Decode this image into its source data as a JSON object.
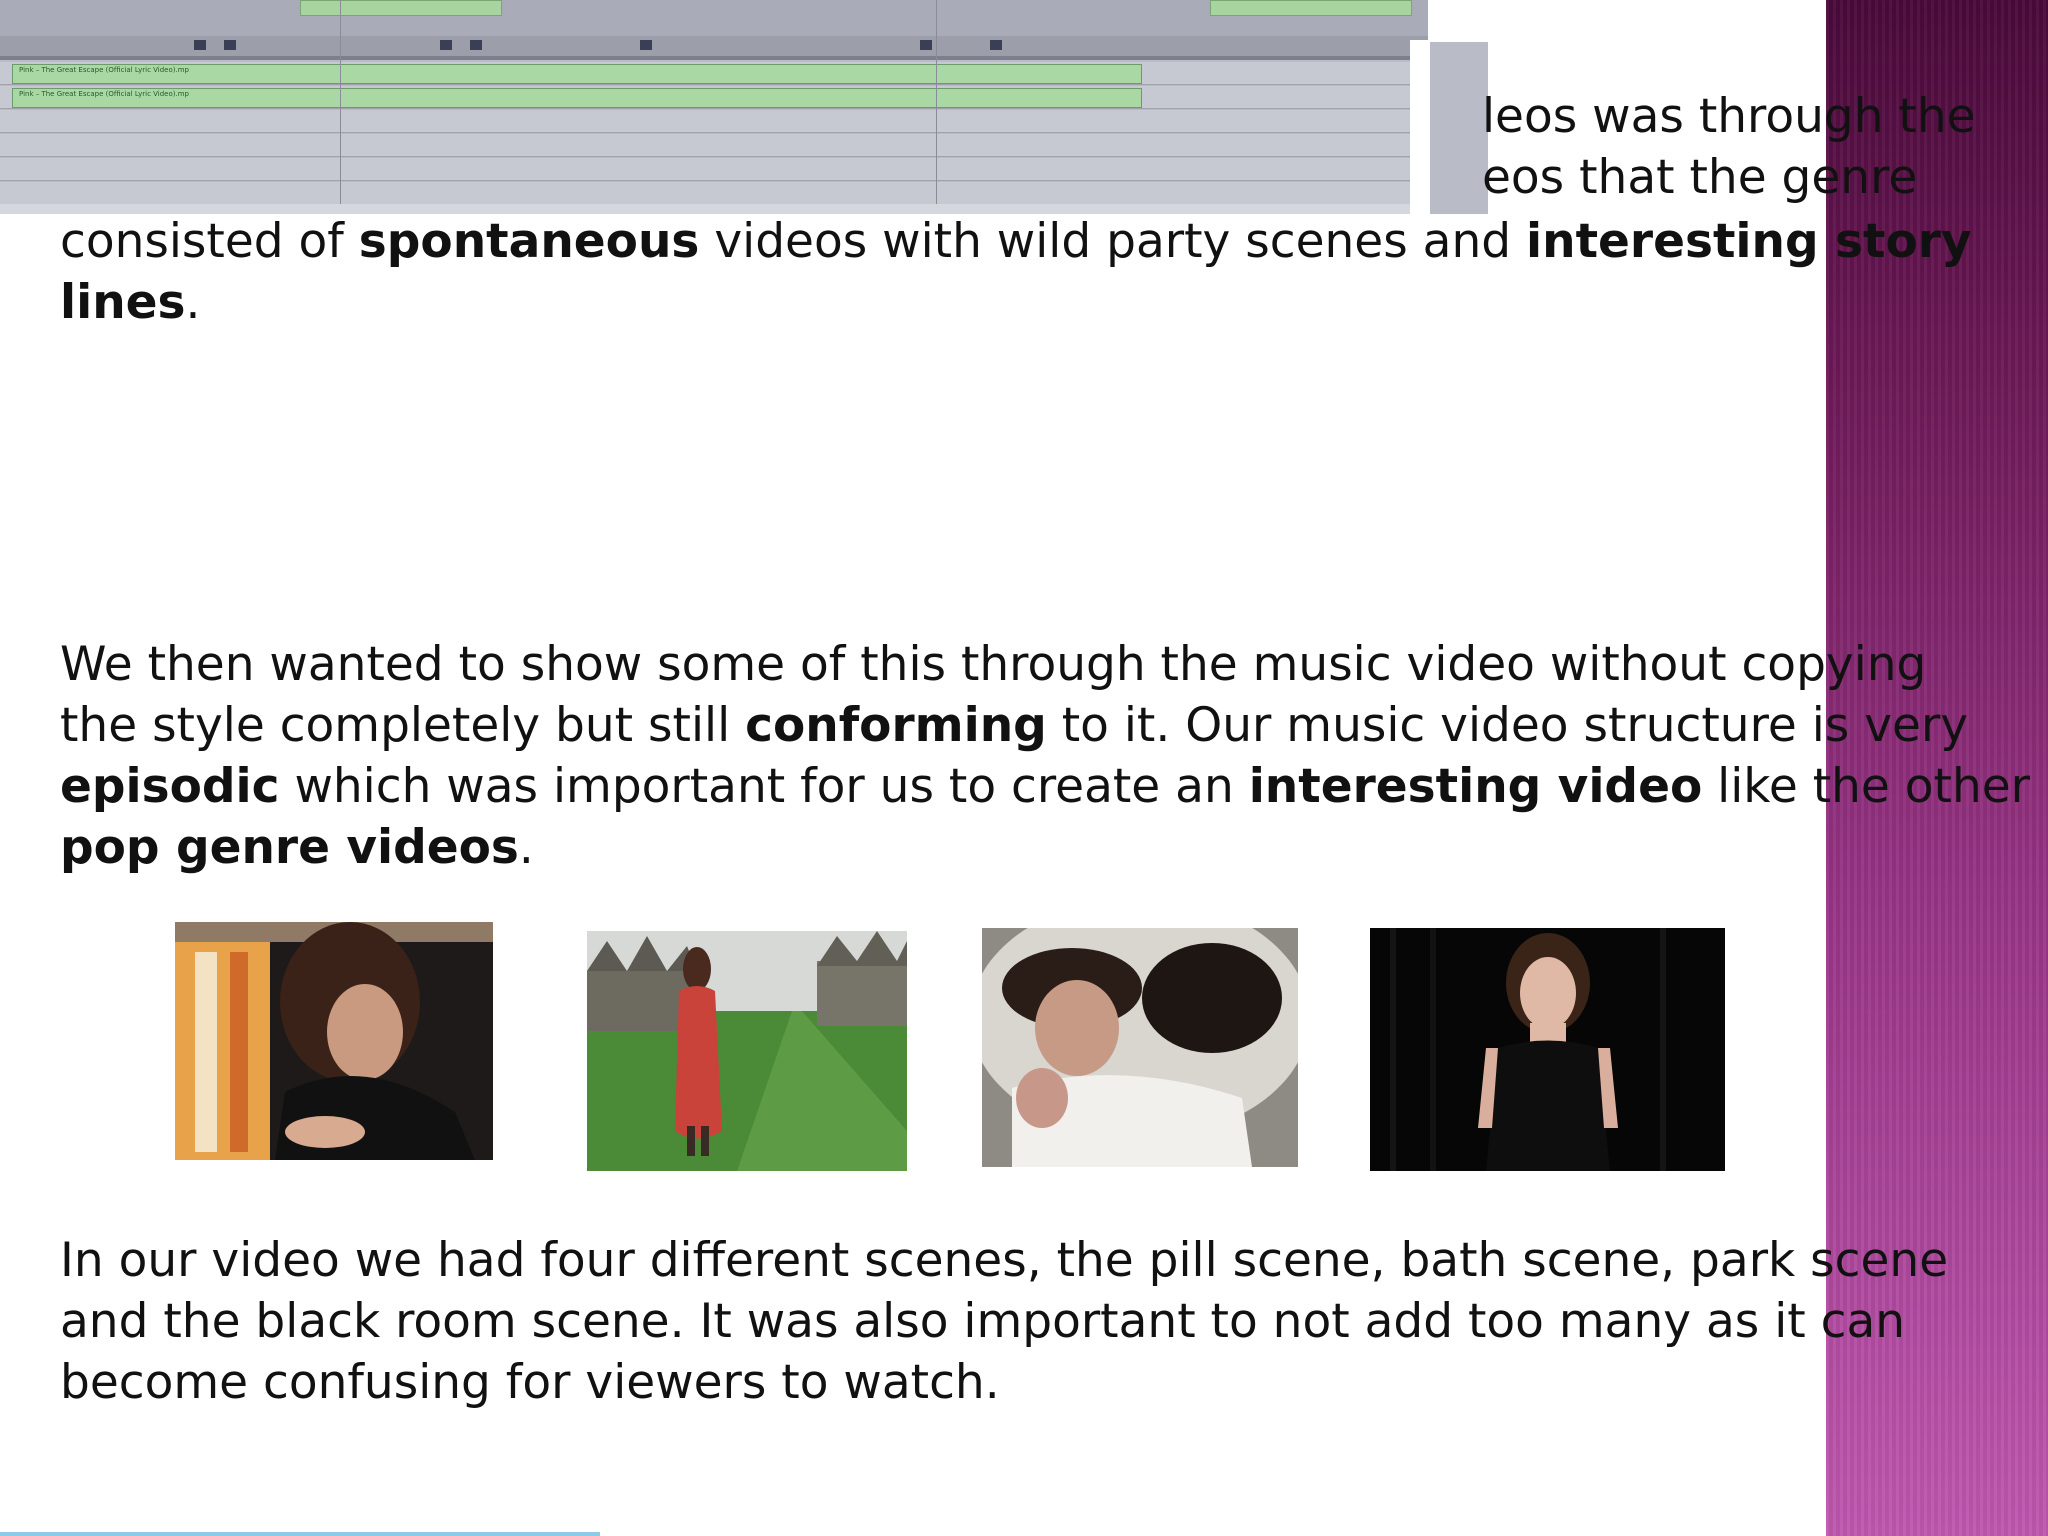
{
  "slide": {
    "paragraph_top_partial": {
      "line1": "leos was through the",
      "line2": "eos that the genre"
    },
    "paragraph_intro": {
      "t1": "consisted of ",
      "b1": "spontaneous",
      "t2": " videos with wild party scenes and ",
      "b2": "interesting story",
      "b3": "lines",
      "t3": "."
    },
    "paragraph_structure": {
      "l1": "We then wanted to show some of this through the music video without copying",
      "l2_t1": "the style completely but still ",
      "l2_b1": "conforming",
      "l2_t2": " to it. Our music video structure is very",
      "l3_b1": "episodic",
      "l3_t1": " which was important for us to create an ",
      "l3_b2": "interesting video",
      "l3_t2": " like the other",
      "l4_b1": "pop genre videos",
      "l4_t1": "."
    },
    "paragraph_scenes": {
      "l1": "In our video we had four different scenes, the pill scene, bath scene, park scene",
      "l2": "and the black room scene. It was also important to not add too many as it can",
      "l3": "become confusing for viewers to watch."
    }
  },
  "timeline": {
    "clip_label": "Pink – The Great Escape (Official Lyric Video).mp"
  },
  "colors": {
    "sidebar_top": "#4a0a3a",
    "sidebar_bottom": "#c058b0",
    "clip_green": "#a9d8a4",
    "timeline_grey": "#b9bcc6"
  }
}
